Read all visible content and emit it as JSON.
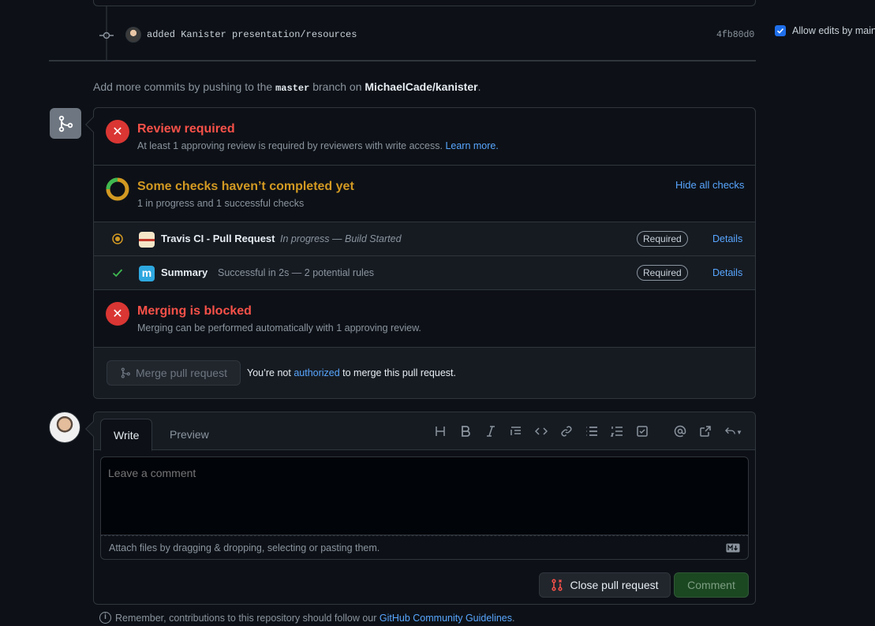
{
  "commit": {
    "message": "added Kanister presentation/resources",
    "sha": "4fb80d0"
  },
  "push_hint": {
    "prefix": "Add more commits by pushing to the ",
    "branch": "master",
    "middle": " branch on ",
    "repo": "MichaelCade/kanister",
    "suffix": "."
  },
  "review": {
    "title": "Review required",
    "desc": "At least 1 approving review is required by reviewers with write access.",
    "learn_more": "Learn more."
  },
  "checks": {
    "title": "Some checks haven’t completed yet",
    "desc": "1 in progress and 1 successful checks",
    "hide_all": "Hide all checks",
    "items": [
      {
        "name": "Travis CI - Pull Request",
        "desc": "In progress — Build Started",
        "badge": "Required",
        "details": "Details",
        "status": "in-progress"
      },
      {
        "name": "Summary",
        "desc": "Successful in 2s — 2 potential rules",
        "badge": "Required",
        "details": "Details",
        "status": "success"
      }
    ]
  },
  "blocked": {
    "title": "Merging is blocked",
    "desc": "Merging can be performed automatically with 1 approving review."
  },
  "merge": {
    "button": "Merge pull request",
    "not_auth_prefix": "You’re not ",
    "not_auth_link": "authorized",
    "not_auth_suffix": " to merge this pull request."
  },
  "comment": {
    "tab_write": "Write",
    "tab_preview": "Preview",
    "placeholder": "Leave a comment",
    "attach": "Attach files by dragging & dropping, selecting or pasting them.",
    "close_pr": "Close pull request",
    "submit": "Comment"
  },
  "footer": {
    "prefix": "Remember, contributions to this repository should follow our ",
    "link": "GitHub Community Guidelines",
    "suffix": "."
  },
  "sidebar": {
    "allow_edits": "Allow edits by maint"
  },
  "colors": {
    "danger": "#da3633",
    "attention": "#d29922",
    "success": "#3fb950",
    "accent": "#58a6ff"
  }
}
